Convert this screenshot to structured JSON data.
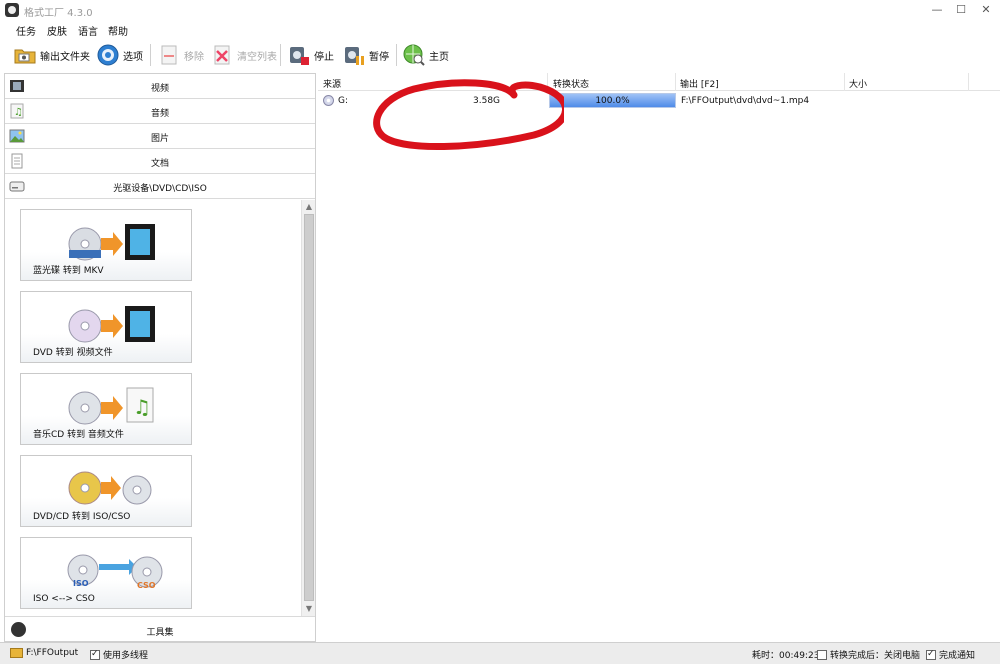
{
  "window": {
    "title": "格式工厂 4.3.0"
  },
  "menu": [
    "任务",
    "皮肤",
    "语言",
    "帮助"
  ],
  "toolbar": {
    "output_folder": "输出文件夹",
    "options": "选项",
    "remove": "移除",
    "clear_list": "清空列表",
    "stop": "停止",
    "pause": "暂停",
    "home": "主页"
  },
  "categories": [
    "视频",
    "音频",
    "图片",
    "文档",
    "光驱设备\\DVD\\CD\\ISO"
  ],
  "converters": [
    "蓝光碟 转到 MKV",
    "DVD 转到 视频文件",
    "音乐CD 转到 音频文件",
    "DVD/CD 转到 ISO/CSO",
    "ISO <--> CSO"
  ],
  "toolbox": "工具集",
  "table": {
    "columns": [
      "来源",
      "转换状态",
      "输出 [F2]",
      "大小"
    ],
    "rows": [
      {
        "source": "G:",
        "size": "3.58G",
        "status": "100.0%",
        "progress": 1.0,
        "output": "F:\\FFOutput\\dvd\\dvd~1.mp4"
      }
    ]
  },
  "statusbar": {
    "folder": "F:\\FFOutput",
    "multithread": "使用多线程",
    "elapsed": "耗时：00:49:23",
    "after_done": "转换完成后：关闭电脑",
    "notify": "完成通知"
  },
  "colors": {
    "annotation": "#d9121b",
    "progress_fill": "#4f8be8"
  }
}
